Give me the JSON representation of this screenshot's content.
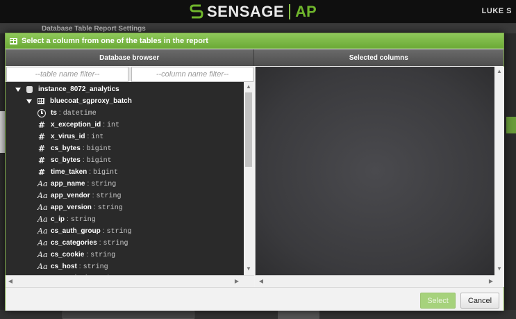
{
  "app": {
    "brand_name": "SENSAGE",
    "brand_sub": "AP",
    "user_name": "LUKE S",
    "background_title": "Database Table Report Settings"
  },
  "dialog": {
    "title": "Select a column from one of the tables in the report",
    "left_header": "Database browser",
    "right_header": "Selected columns",
    "table_filter_placeholder": "--table name filter--",
    "column_filter_placeholder": "--column name filter--",
    "select_label": "Select",
    "cancel_label": "Cancel"
  },
  "tree": {
    "database": "instance_8072_analytics",
    "table": "bluecoat_sgproxy_batch",
    "fields": [
      {
        "name": "ts",
        "type": "datetime",
        "icon": "clock-icon"
      },
      {
        "name": "x_exception_id",
        "type": "int",
        "icon": "hash-icon"
      },
      {
        "name": "x_virus_id",
        "type": "int",
        "icon": "hash-icon"
      },
      {
        "name": "cs_bytes",
        "type": "bigint",
        "icon": "hash-icon"
      },
      {
        "name": "sc_bytes",
        "type": "bigint",
        "icon": "hash-icon"
      },
      {
        "name": "time_taken",
        "type": "bigint",
        "icon": "hash-icon"
      },
      {
        "name": "app_name",
        "type": "string",
        "icon": "text-type-icon"
      },
      {
        "name": "app_vendor",
        "type": "string",
        "icon": "text-type-icon"
      },
      {
        "name": "app_version",
        "type": "string",
        "icon": "text-type-icon"
      },
      {
        "name": "c_ip",
        "type": "string",
        "icon": "text-type-icon"
      },
      {
        "name": "cs_auth_group",
        "type": "string",
        "icon": "text-type-icon"
      },
      {
        "name": "cs_categories",
        "type": "string",
        "icon": "text-type-icon"
      },
      {
        "name": "cs_cookie",
        "type": "string",
        "icon": "text-type-icon"
      },
      {
        "name": "cs_host",
        "type": "string",
        "icon": "text-type-icon"
      },
      {
        "name": "cs_method",
        "type": "string",
        "icon": "text-type-icon"
      }
    ]
  },
  "colors": {
    "accent_green": "#6aa935",
    "header_gray": "#555555",
    "tree_bg": "#2a2a2a"
  }
}
